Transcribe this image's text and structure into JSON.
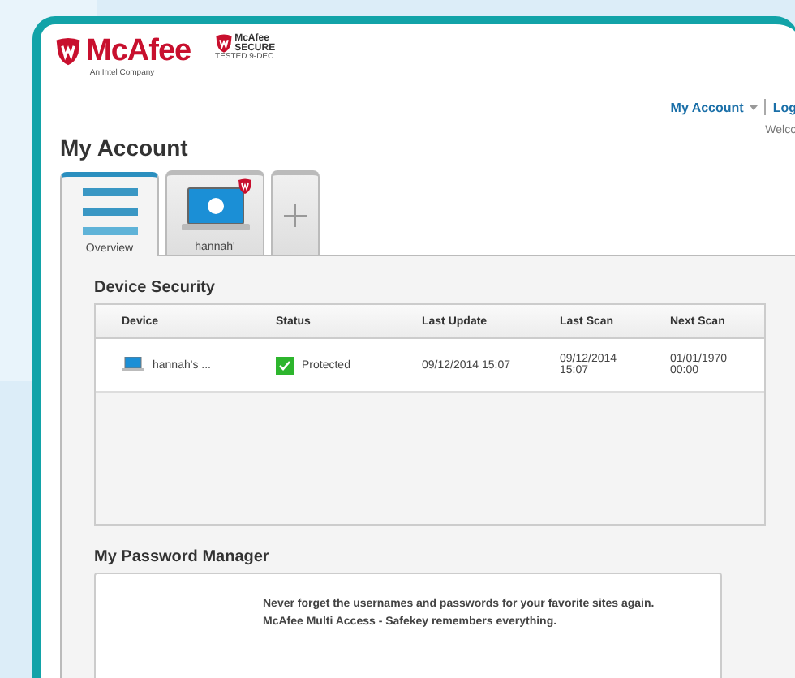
{
  "header": {
    "brand": "McAfee",
    "brand_tagline": "An Intel Company",
    "badge_brand": "McAfee",
    "badge_word": "SECURE",
    "badge_tested": "TESTED 9-DEC",
    "links": [
      "My Account",
      "Log"
    ],
    "welcome": "Welco"
  },
  "title": "My Account",
  "tabs": [
    {
      "kind": "overview",
      "label": "Overview",
      "selected": true
    },
    {
      "kind": "device",
      "label": "hannah'",
      "selected": false
    },
    {
      "kind": "add",
      "selected": false
    }
  ],
  "device_security": {
    "title": "Device Security",
    "columns": [
      "Device",
      "Status",
      "Last Update",
      "Last Scan",
      "Next Scan"
    ],
    "rows": [
      {
        "device": "hannah's ...",
        "status": "Protected",
        "protected": true,
        "last_update": "09/12/2014 15:07",
        "last_scan": "09/12/2014 15:07",
        "next_scan": "01/01/1970 00:00"
      }
    ]
  },
  "password_manager": {
    "title": "My Password Manager",
    "lines": [
      "Never forget the usernames and passwords for your favorite sites again.",
      "McAfee Multi Access - Safekey remembers everything."
    ]
  }
}
